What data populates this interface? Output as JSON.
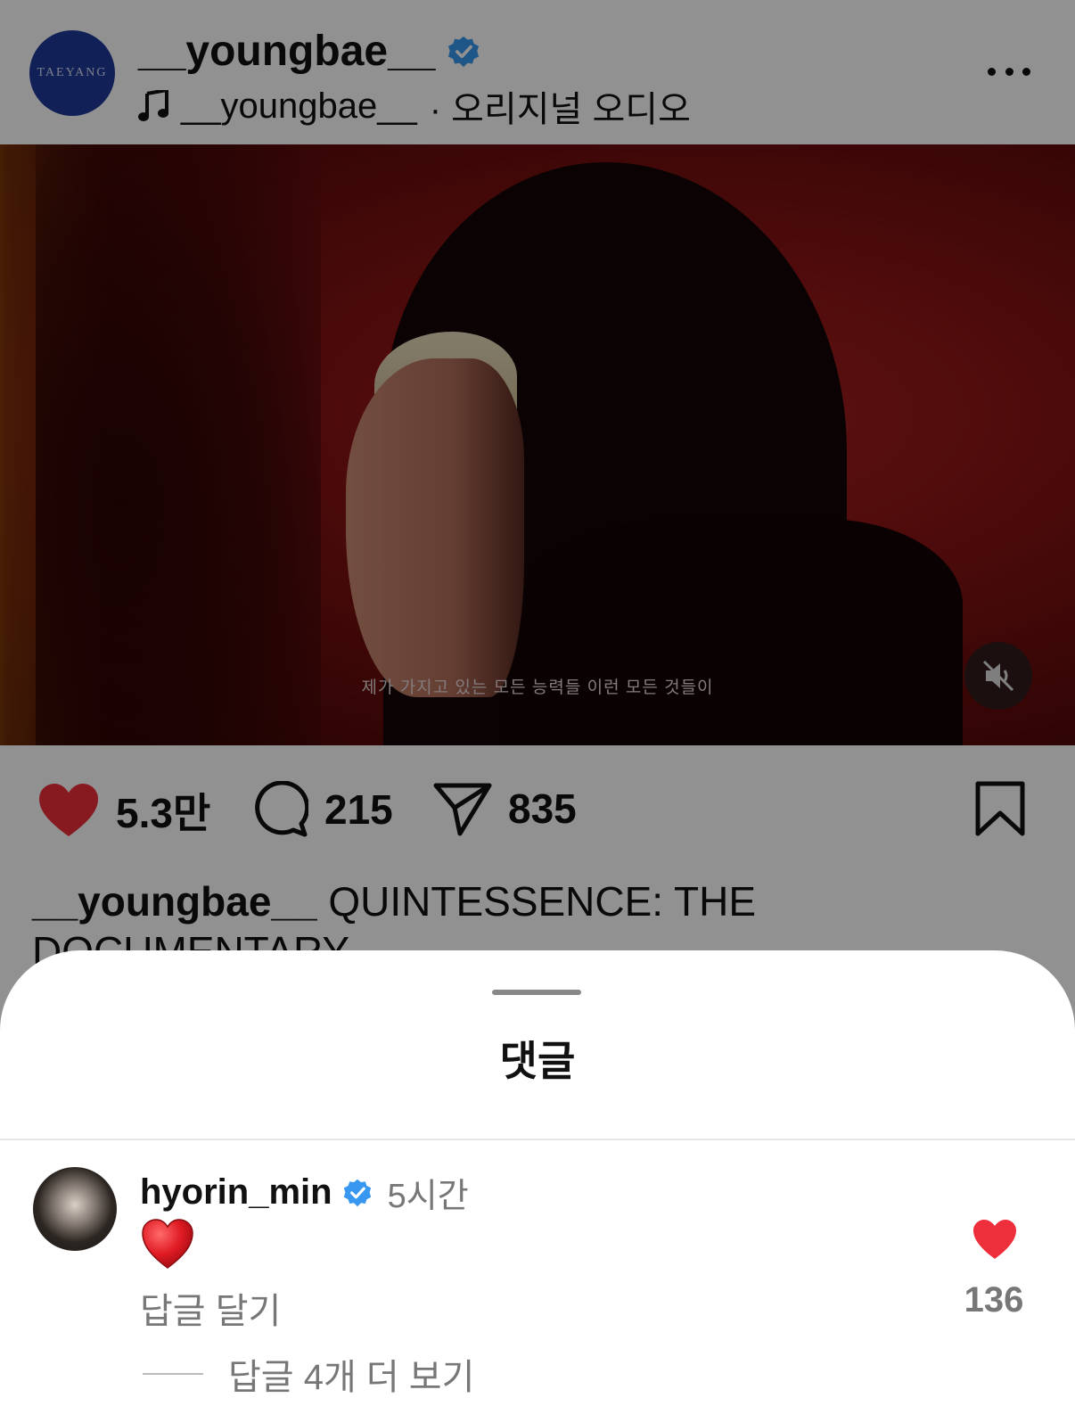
{
  "post": {
    "avatar_text": "TAEYANG",
    "username": "__youngbae__",
    "audio_user": "__youngbae__",
    "audio_label": "· 오리지널 오디오",
    "video_subtitle": "제가 가지고 있는 모든 능력들 이런 모든 것들이",
    "likes": "5.3만",
    "comments": "215",
    "shares": "835",
    "caption_user": "__youngbae__",
    "caption_text": "QUINTESSENCE: THE DOCUMENTARY"
  },
  "sheet": {
    "title": "댓글"
  },
  "comment": {
    "username": "hyorin_min",
    "time": "5시간",
    "reply_label": "답글 달기",
    "like_count": "136",
    "more_replies": "답글 4개 더 보기"
  },
  "colors": {
    "verified": "#3897f0",
    "heart": "#ed2f3b",
    "dim": "rgba(0,0,0,0.43)"
  }
}
